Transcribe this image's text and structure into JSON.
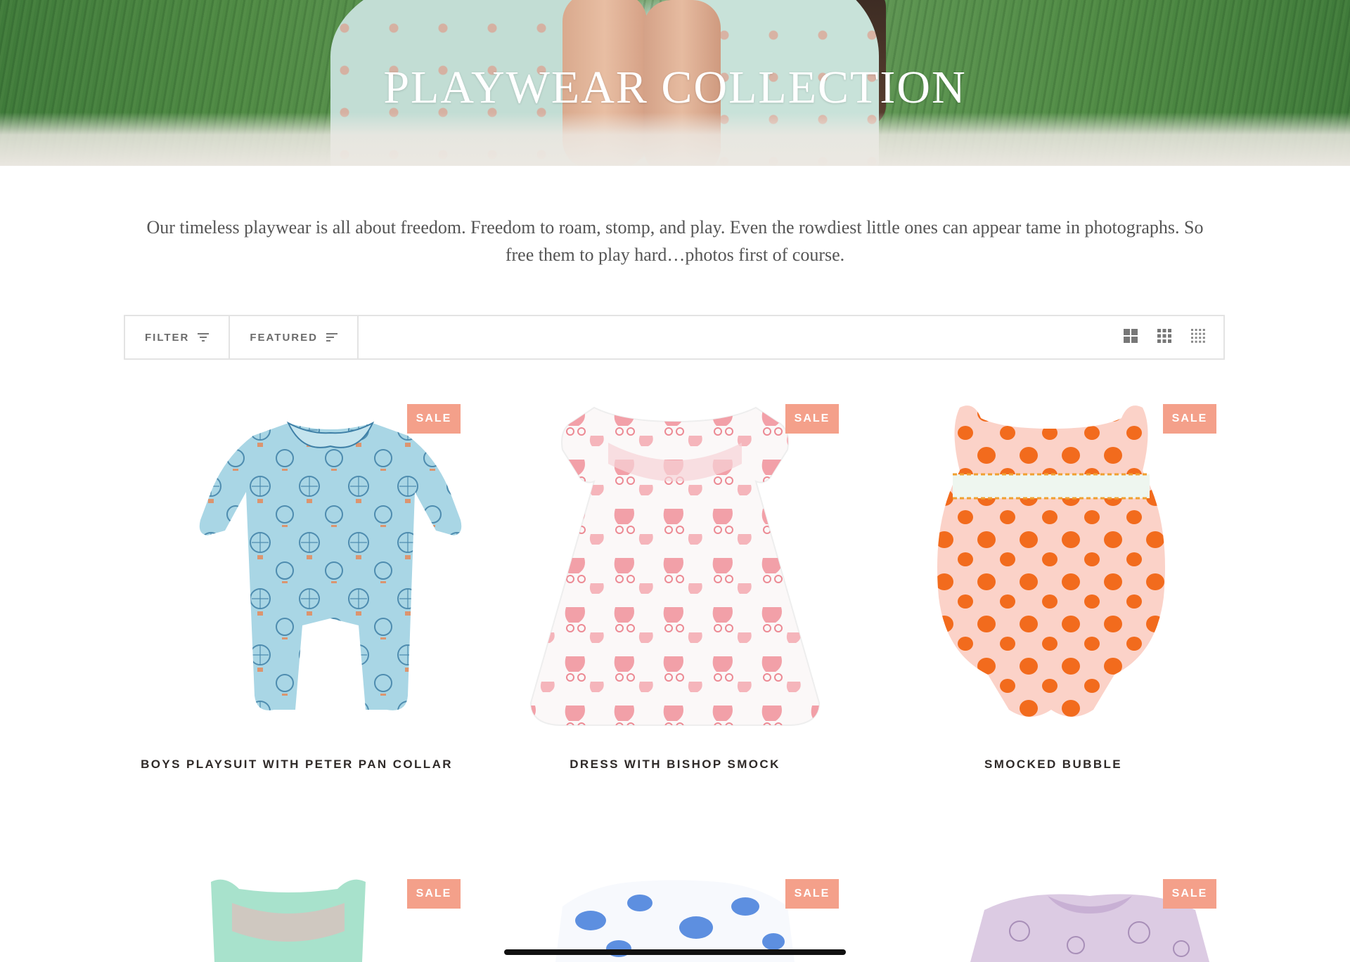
{
  "hero": {
    "title": "PLAYWEAR COLLECTION"
  },
  "intro": {
    "text": "Our timeless playwear is all about freedom. Freedom to roam, stomp, and play. Even the rowdiest little ones can appear tame in photographs. So free them to play hard…photos first of course."
  },
  "toolbar": {
    "filter_label": "FILTER",
    "sort_label": "FEATURED",
    "view_options": [
      "grid-2-icon",
      "grid-3-icon",
      "grid-4-icon"
    ]
  },
  "colors": {
    "sale_badge": "#f4a08a",
    "product_name": "#2f2a28",
    "border": "#e3e3e3"
  },
  "products": [
    {
      "name": "BOYS PLAYSUIT WITH PETER PAN COLLAR",
      "badge": "SALE"
    },
    {
      "name": "DRESS WITH BISHOP SMOCK",
      "badge": "SALE"
    },
    {
      "name": "SMOCKED BUBBLE",
      "badge": "SALE"
    },
    {
      "name": "",
      "badge": "SALE"
    },
    {
      "name": "",
      "badge": "SALE"
    },
    {
      "name": "",
      "badge": "SALE"
    }
  ]
}
